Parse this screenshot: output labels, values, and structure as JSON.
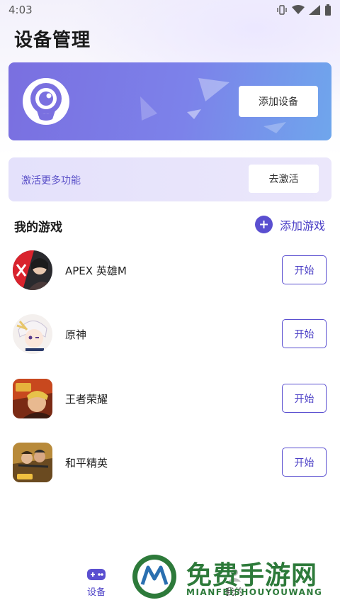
{
  "status_bar": {
    "time": "4:03"
  },
  "header": {
    "title": "设备管理"
  },
  "device_card": {
    "add_device_label": "添加设备"
  },
  "activation": {
    "text": "激活更多功能",
    "button_label": "去激活"
  },
  "games_section": {
    "title": "我的游戏",
    "add_game_label": "添加游戏",
    "games": [
      {
        "name": "APEX 英雄M",
        "start_label": "开始",
        "icon": "apex-icon"
      },
      {
        "name": "原神",
        "start_label": "开始",
        "icon": "genshin-icon"
      },
      {
        "name": "王者荣耀",
        "start_label": "开始",
        "icon": "honor-of-kings-icon"
      },
      {
        "name": "和平精英",
        "start_label": "开始",
        "icon": "peace-elite-icon"
      }
    ]
  },
  "bottom_nav": {
    "items": [
      {
        "label": "设备",
        "icon": "gamepad-icon",
        "active": true
      },
      {
        "label": "我的",
        "icon": "user-icon",
        "active": false
      }
    ]
  },
  "watermark": {
    "title": "免费手游网",
    "subtitle": "MIANFEISHOUYOUWANG"
  },
  "colors": {
    "accent": "#5a4fd0",
    "card_start": "#7a6fe0",
    "card_end": "#6fa6ec",
    "watermark": "#2d7a3a"
  }
}
